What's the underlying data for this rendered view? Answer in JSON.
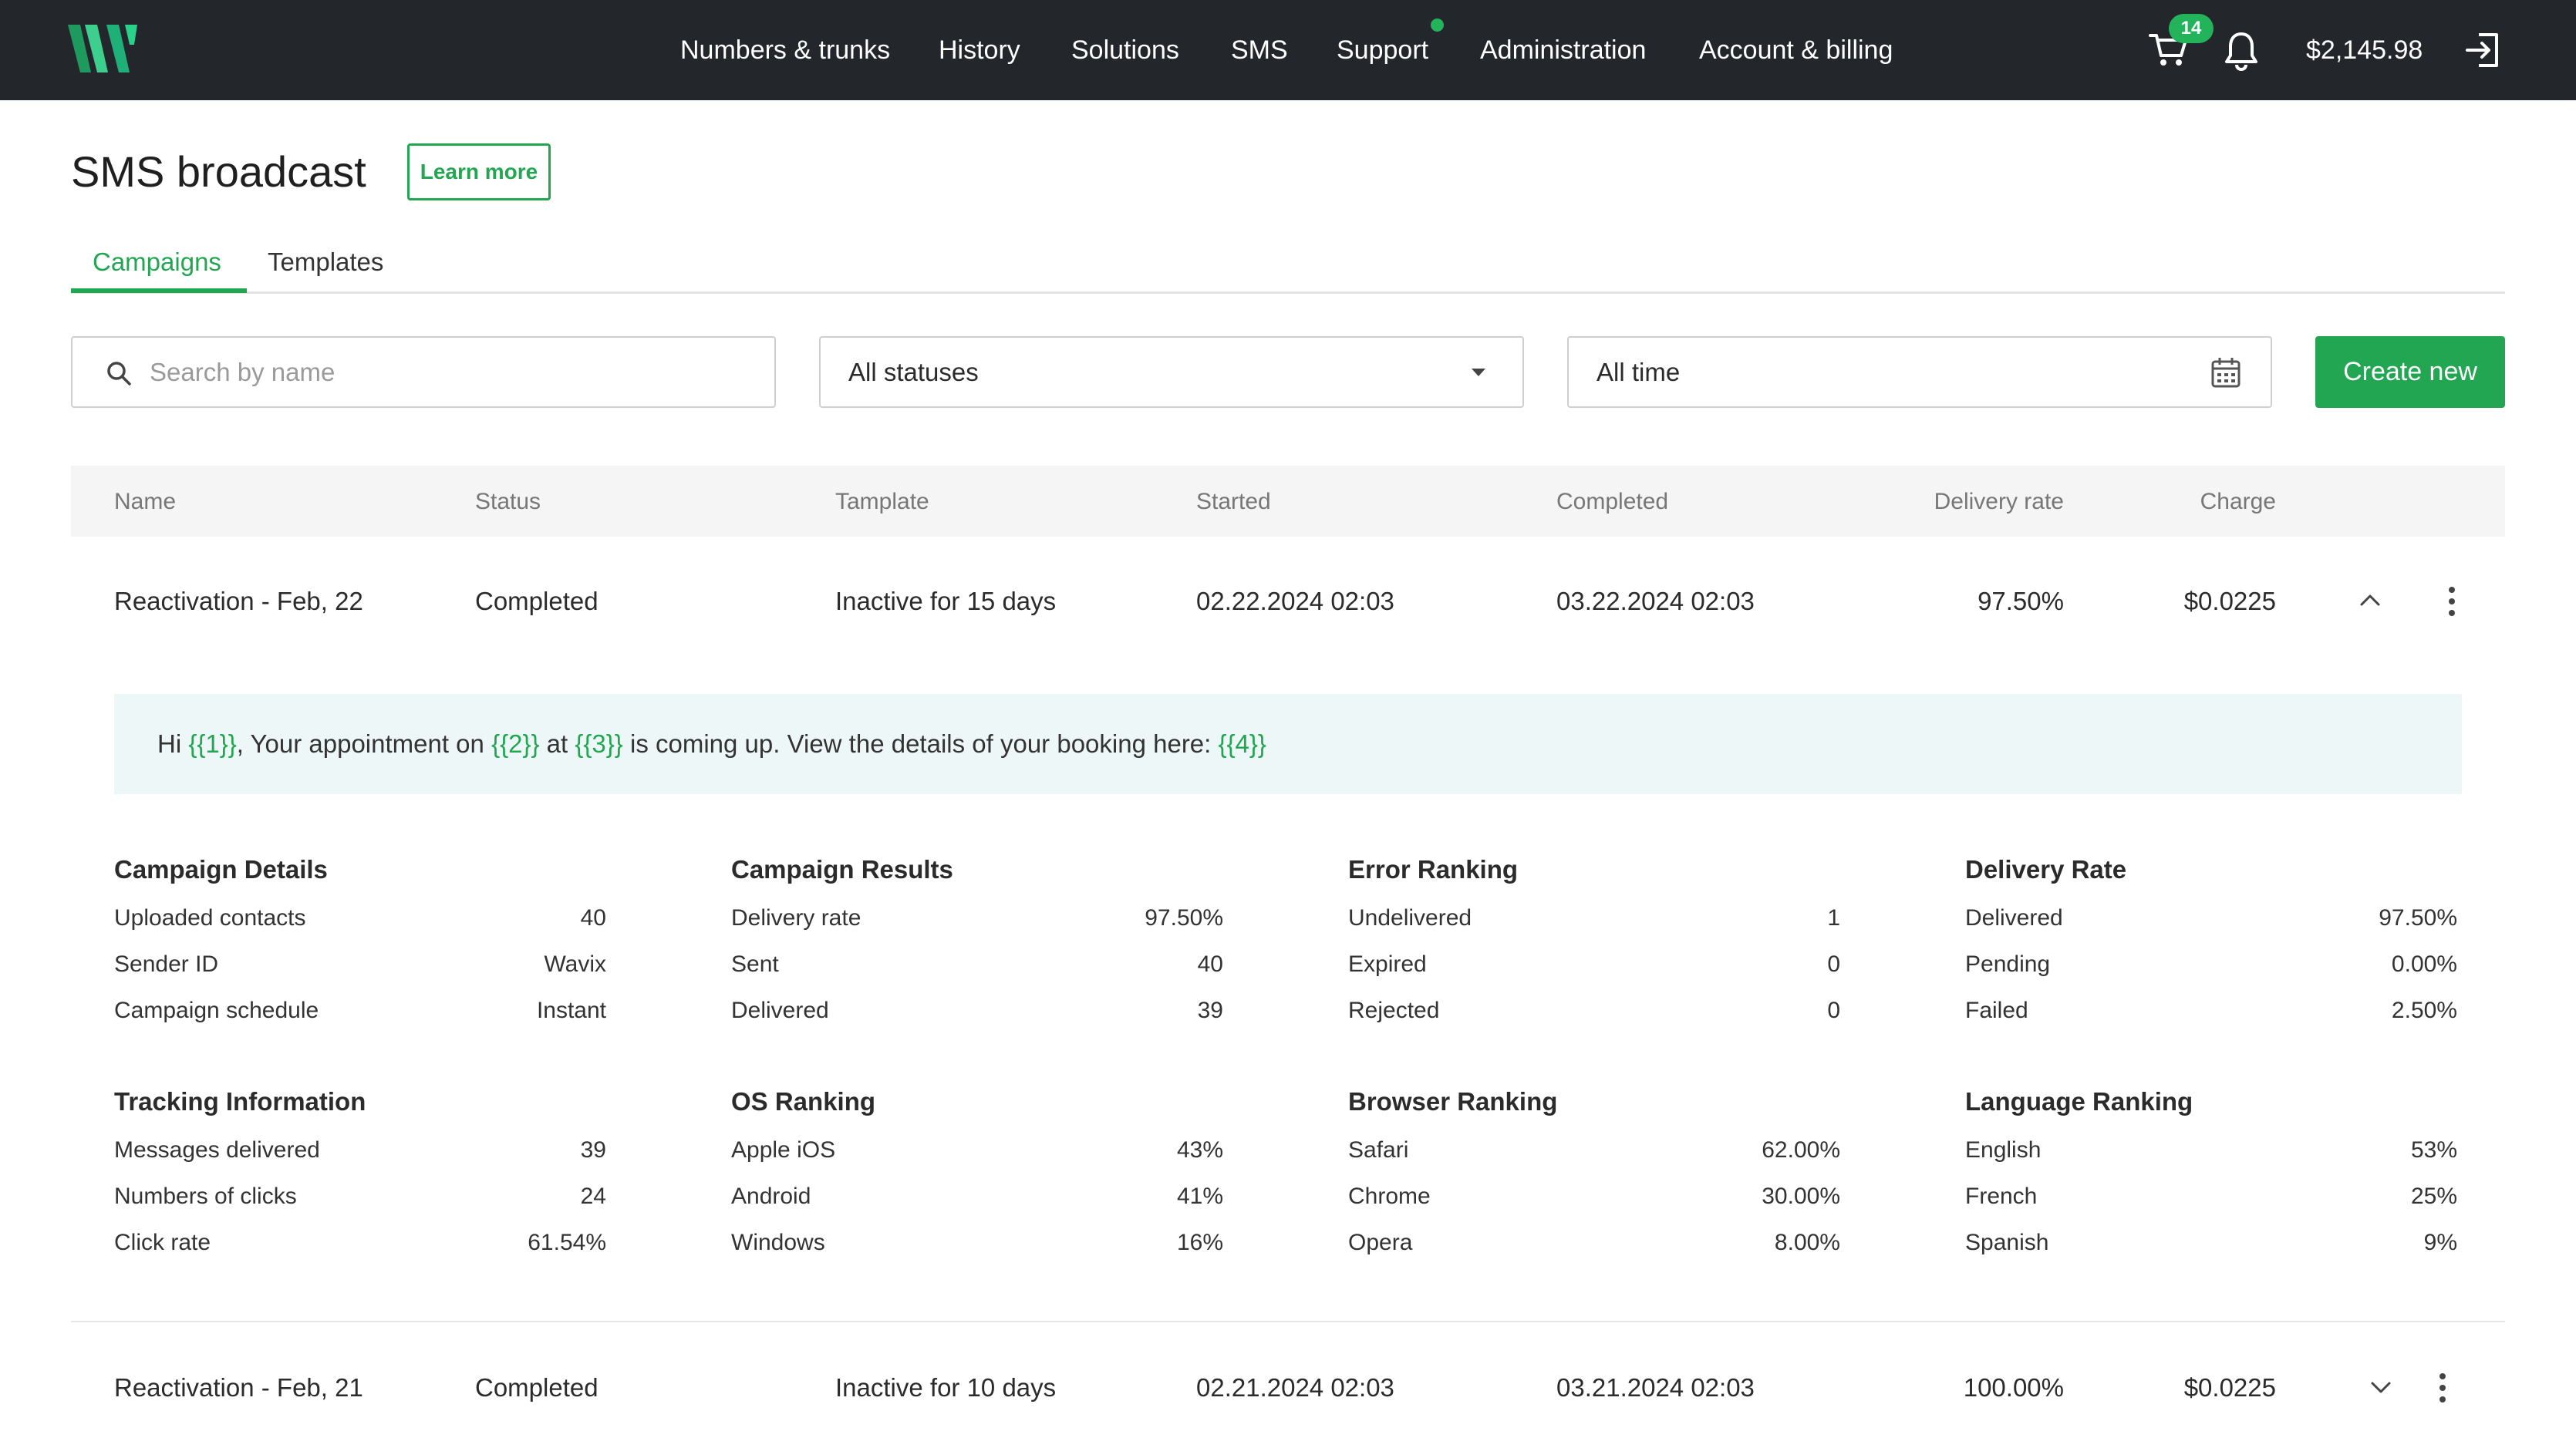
{
  "nav": {
    "items": [
      "Numbers & trunks",
      "History",
      "Solutions",
      "SMS",
      "Support",
      "Administration",
      "Account & billing"
    ],
    "cart_count": "14",
    "balance": "$2,145.98"
  },
  "header": {
    "title": "SMS broadcast",
    "learn_more": "Learn more"
  },
  "tabs": [
    {
      "label": "Campaigns",
      "active": true
    },
    {
      "label": "Templates",
      "active": false
    }
  ],
  "filters": {
    "search_placeholder": "Search by name",
    "status_value": "All statuses",
    "date_value": "All time",
    "create_label": "Create new"
  },
  "table": {
    "columns": [
      "Name",
      "Status",
      "Tamplate",
      "Started",
      "Completed",
      "Delivery rate",
      "Charge"
    ],
    "rows": [
      {
        "name": "Reactivation - Feb, 22",
        "status": "Completed",
        "template": "Inactive for 15 days",
        "started": "02.22.2024 02:03",
        "completed": "03.22.2024 02:03",
        "delivery_rate": "97.50%",
        "charge": "$0.0225",
        "expanded": true
      },
      {
        "name": "Reactivation - Feb, 21",
        "status": "Completed",
        "template": "Inactive for 10 days",
        "started": "02.21.2024 02:03",
        "completed": "03.21.2024 02:03",
        "delivery_rate": "100.00%",
        "charge": "$0.0225",
        "expanded": false
      }
    ]
  },
  "message": {
    "t1": "Hi ",
    "v1": "{{1}}",
    "t2": ", Your appointment on ",
    "v2": "{{2}}",
    "t3": " at ",
    "v3": "{{3}}",
    "t4": " is coming up. View the details of your booking here: ",
    "v4": "{{4}}"
  },
  "stats": [
    {
      "title": "Campaign Details",
      "rows": [
        [
          "Uploaded contacts",
          "40"
        ],
        [
          "Sender ID",
          "Wavix"
        ],
        [
          "Campaign schedule",
          "Instant"
        ]
      ]
    },
    {
      "title": "Campaign Results",
      "rows": [
        [
          "Delivery rate",
          "97.50%"
        ],
        [
          "Sent",
          "40"
        ],
        [
          "Delivered",
          "39"
        ]
      ]
    },
    {
      "title": "Error Ranking",
      "rows": [
        [
          "Undelivered",
          "1"
        ],
        [
          "Expired",
          "0"
        ],
        [
          "Rejected",
          "0"
        ]
      ]
    },
    {
      "title": "Delivery Rate",
      "rows": [
        [
          "Delivered",
          "97.50%"
        ],
        [
          "Pending",
          "0.00%"
        ],
        [
          "Failed",
          "2.50%"
        ]
      ]
    },
    {
      "title": "Tracking Information",
      "rows": [
        [
          "Messages delivered",
          "39"
        ],
        [
          "Numbers of clicks",
          "24"
        ],
        [
          "Click rate",
          "61.54%"
        ]
      ]
    },
    {
      "title": "OS Ranking",
      "rows": [
        [
          "Apple iOS",
          "43%"
        ],
        [
          "Android",
          "41%"
        ],
        [
          "Windows",
          "16%"
        ]
      ]
    },
    {
      "title": "Browser Ranking",
      "rows": [
        [
          "Safari",
          "62.00%"
        ],
        [
          "Chrome",
          "30.00%"
        ],
        [
          "Opera",
          "8.00%"
        ]
      ]
    },
    {
      "title": "Language Ranking",
      "rows": [
        [
          "English",
          "53%"
        ],
        [
          "French",
          "25%"
        ],
        [
          "Spanish",
          "9%"
        ]
      ]
    }
  ],
  "colors": {
    "accent": "#22a651",
    "topbar": "#23262b",
    "preview_bg": "#eef7f8"
  }
}
